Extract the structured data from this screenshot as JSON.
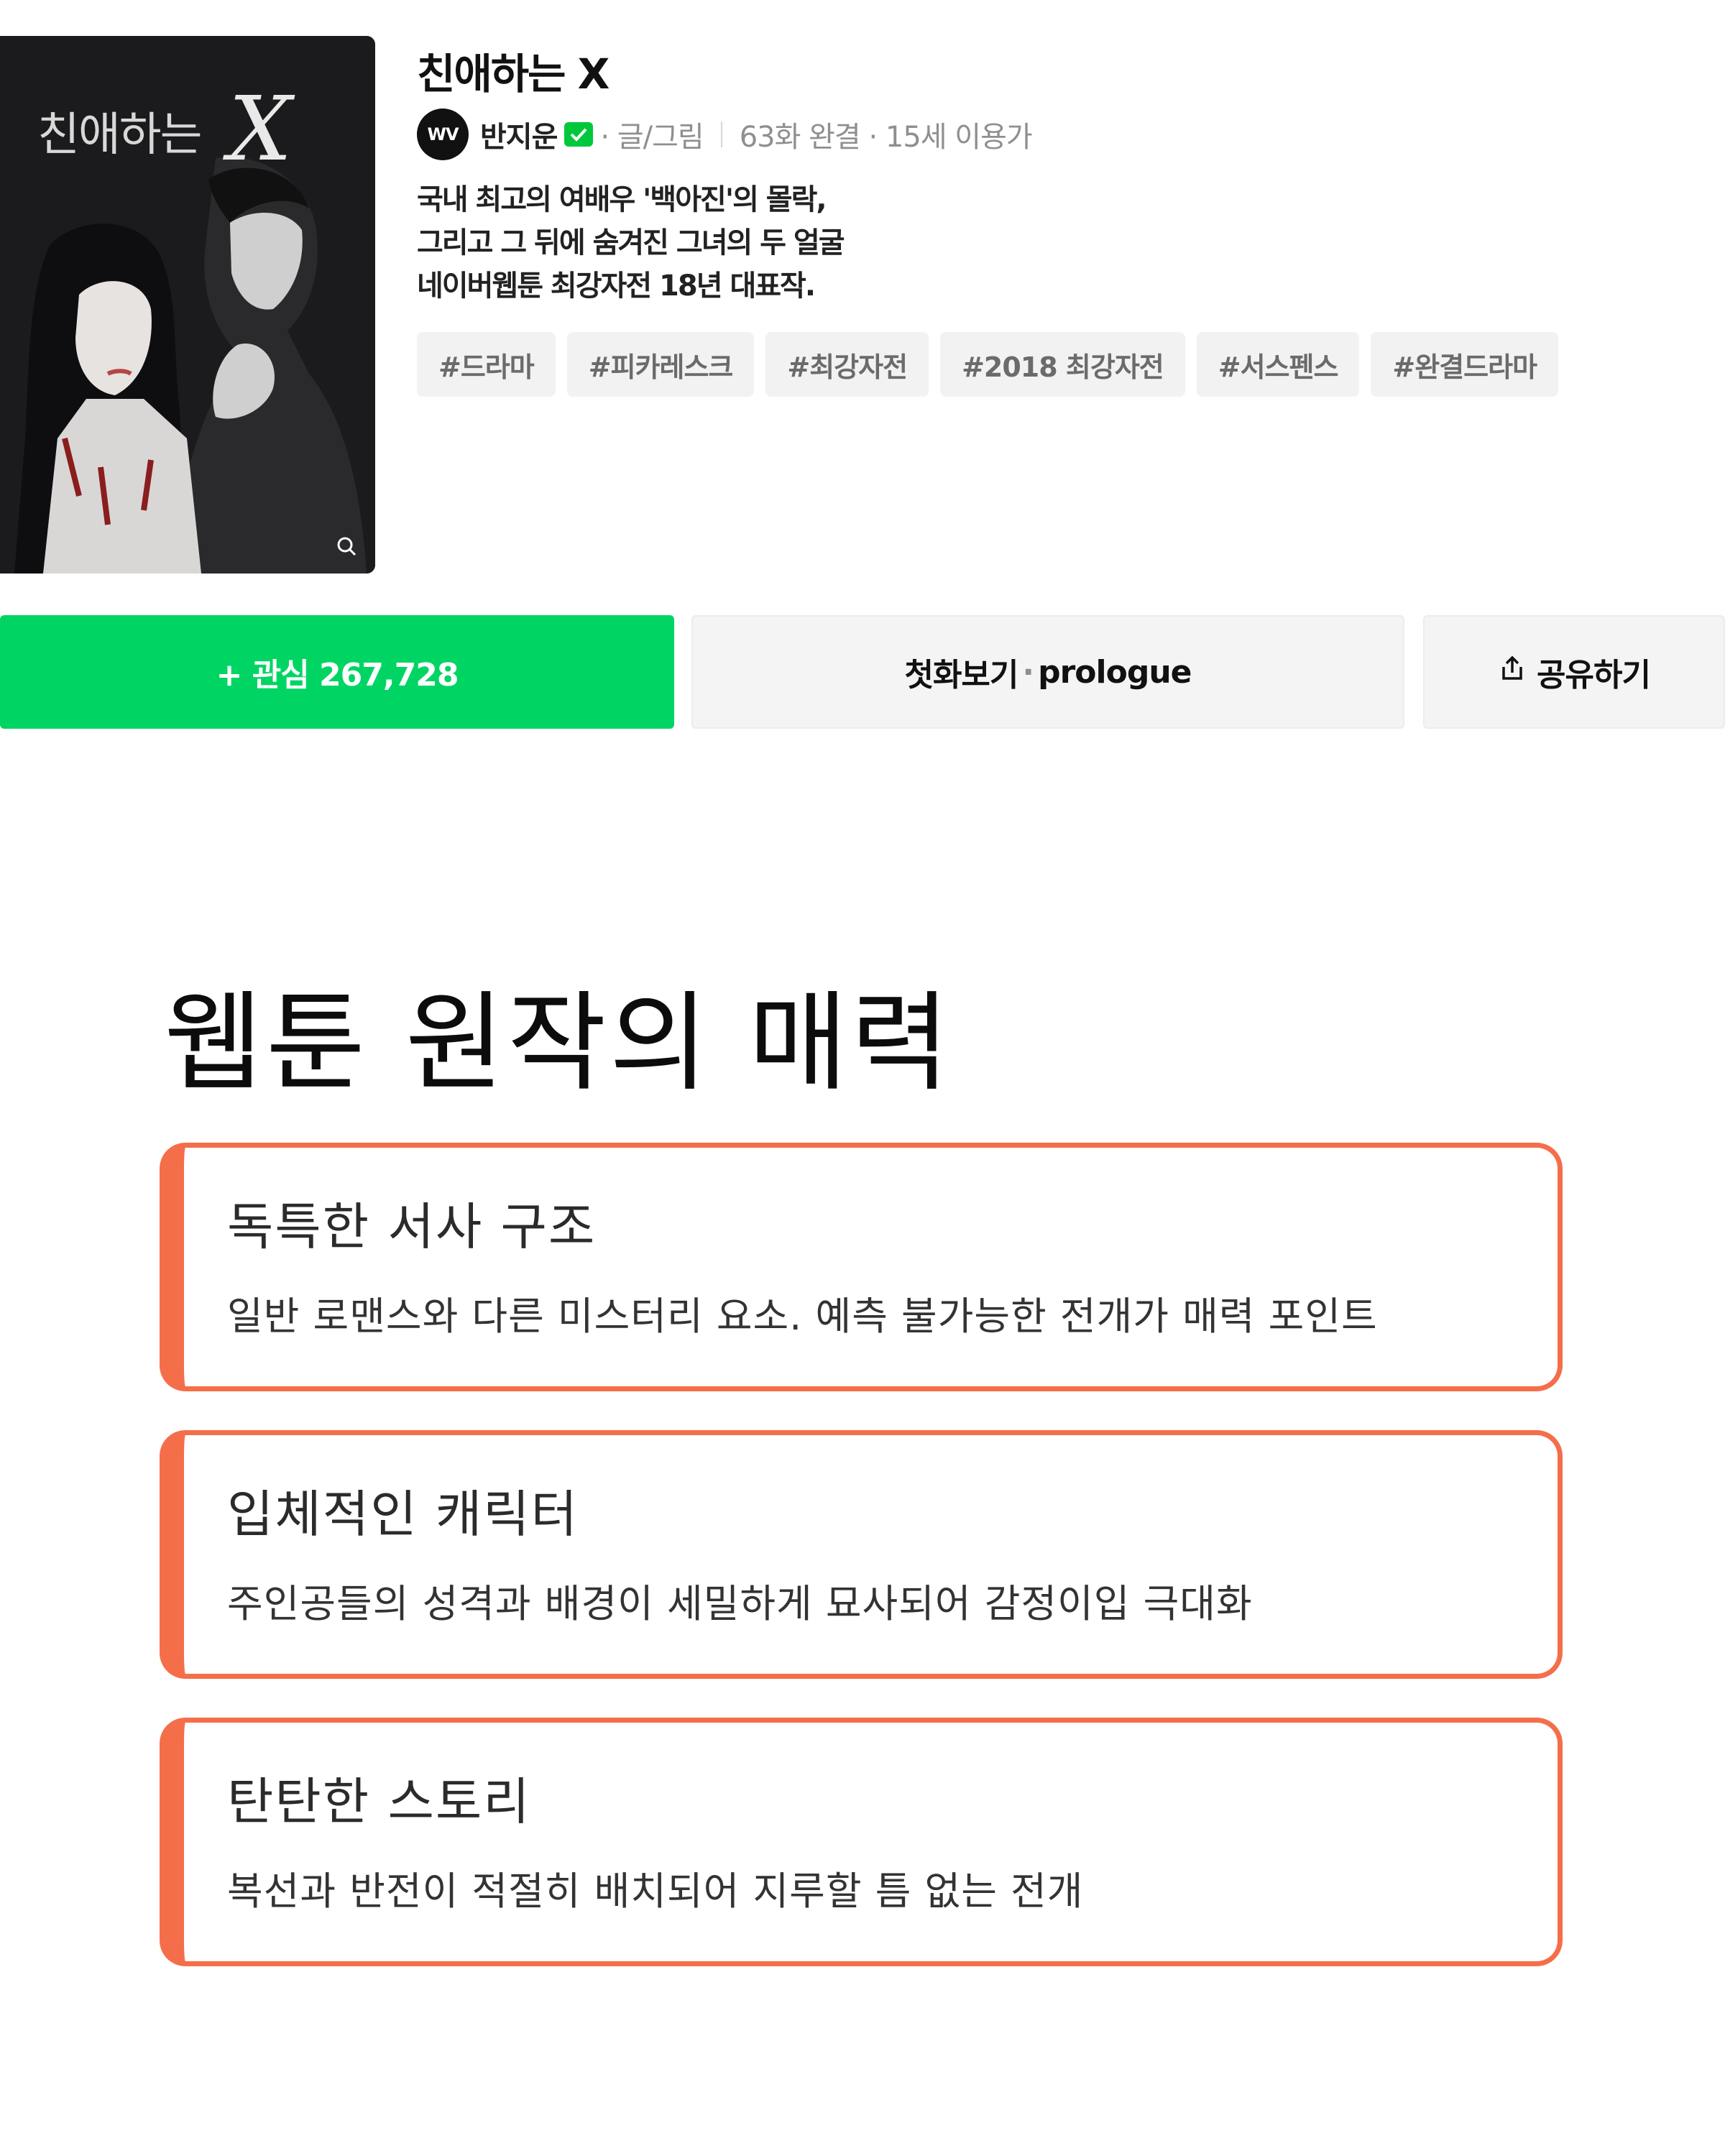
{
  "cover": {
    "title_text": "친애하는",
    "x_text": "X",
    "zoom_icon": "zoom-icon"
  },
  "webtoon": {
    "title": "친애하는 X",
    "author_avatar": "WV",
    "author": "반지운",
    "role": "· 글/그림",
    "status": "63화 완결 · 15세 이용가",
    "description": [
      "국내 최고의 여배우 '백아진'의 몰락,",
      "그리고 그 뒤에 숨겨진 그녀의 두 얼굴",
      "네이버웹툰 최강자전 18년 대표작."
    ],
    "tags": [
      "#드라마",
      "#피카레스크",
      "#최강자전",
      "#2018 최강자전",
      "#서스펜스",
      "#완결드라마"
    ]
  },
  "actions": {
    "follow_label": "+ 관심 267,728",
    "first_label": "첫화보기",
    "first_sub": "prologue",
    "share_label": "공유하기"
  },
  "section": {
    "title": "웹툰 원작의 매력",
    "cards": [
      {
        "title": "독특한 서사 구조",
        "text": "일반 로맨스와 다른 미스터리 요소. 예측 불가능한 전개가 매력 포인트"
      },
      {
        "title": "입체적인 캐릭터",
        "text": "주인공들의 성격과 배경이 세밀하게 묘사되어 감정이입 극대화"
      },
      {
        "title": "탄탄한 스토리",
        "text": "복선과 반전이 적절히 배치되어 지루할 틈 없는 전개"
      }
    ]
  },
  "colors": {
    "brand_green": "#00d564",
    "verified_green": "#00c73c",
    "card_accent": "#f56e4a"
  }
}
